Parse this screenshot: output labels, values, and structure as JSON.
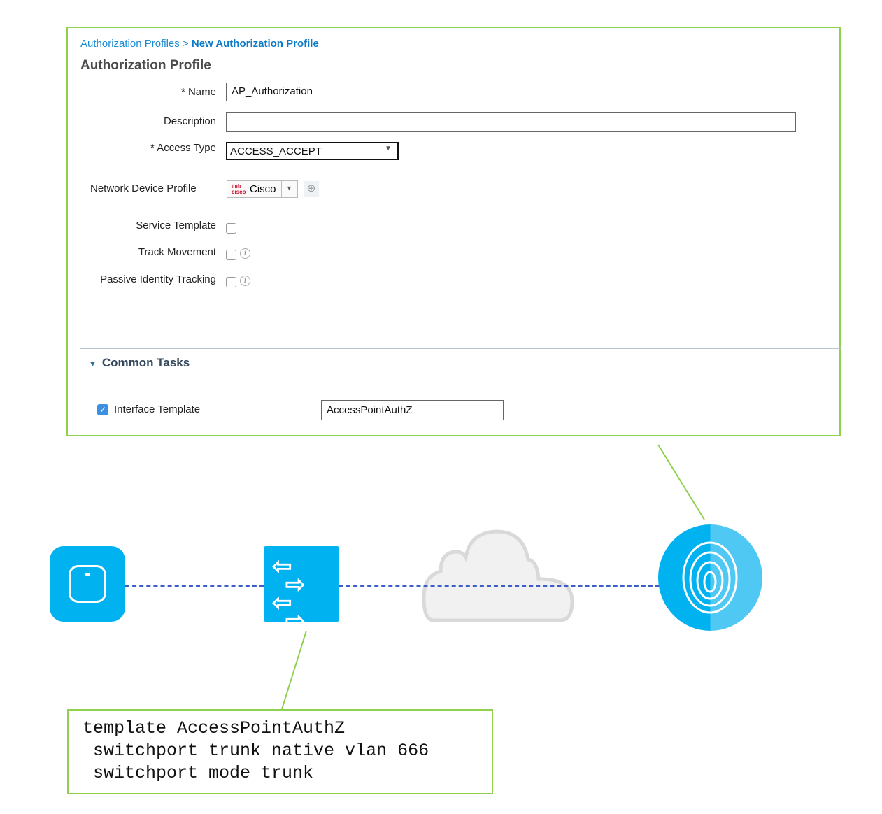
{
  "breadcrumb": {
    "parent": "Authorization Profiles",
    "separator": ">",
    "current": "New Authorization Profile"
  },
  "title": "Authorization Profile",
  "form": {
    "name_label": "* Name",
    "name_value": "AP_Authorization",
    "description_label": "Description",
    "description_value": "",
    "access_type_label": "* Access Type",
    "access_type_value": "ACCESS_ACCEPT",
    "ndp_label": "Network Device Profile",
    "ndp_value": "Cisco",
    "ndp_logo": "cisco",
    "service_template_label": "Service Template",
    "service_template_checked": false,
    "track_movement_label": "Track Movement",
    "track_movement_checked": false,
    "passive_identity_label": "Passive Identity Tracking",
    "passive_identity_checked": false
  },
  "common_tasks": {
    "label": "Common Tasks",
    "interface_template_label": "Interface Template",
    "interface_template_checked": true,
    "interface_template_value": "AccessPointAuthZ"
  },
  "code_lines": [
    "template AccessPointAuthZ",
    " switchport trunk native vlan 666",
    " switchport mode trunk"
  ],
  "colors": {
    "accent": "#00b2f0",
    "border_green": "#8fd14f",
    "link": "#1a8bd1"
  }
}
